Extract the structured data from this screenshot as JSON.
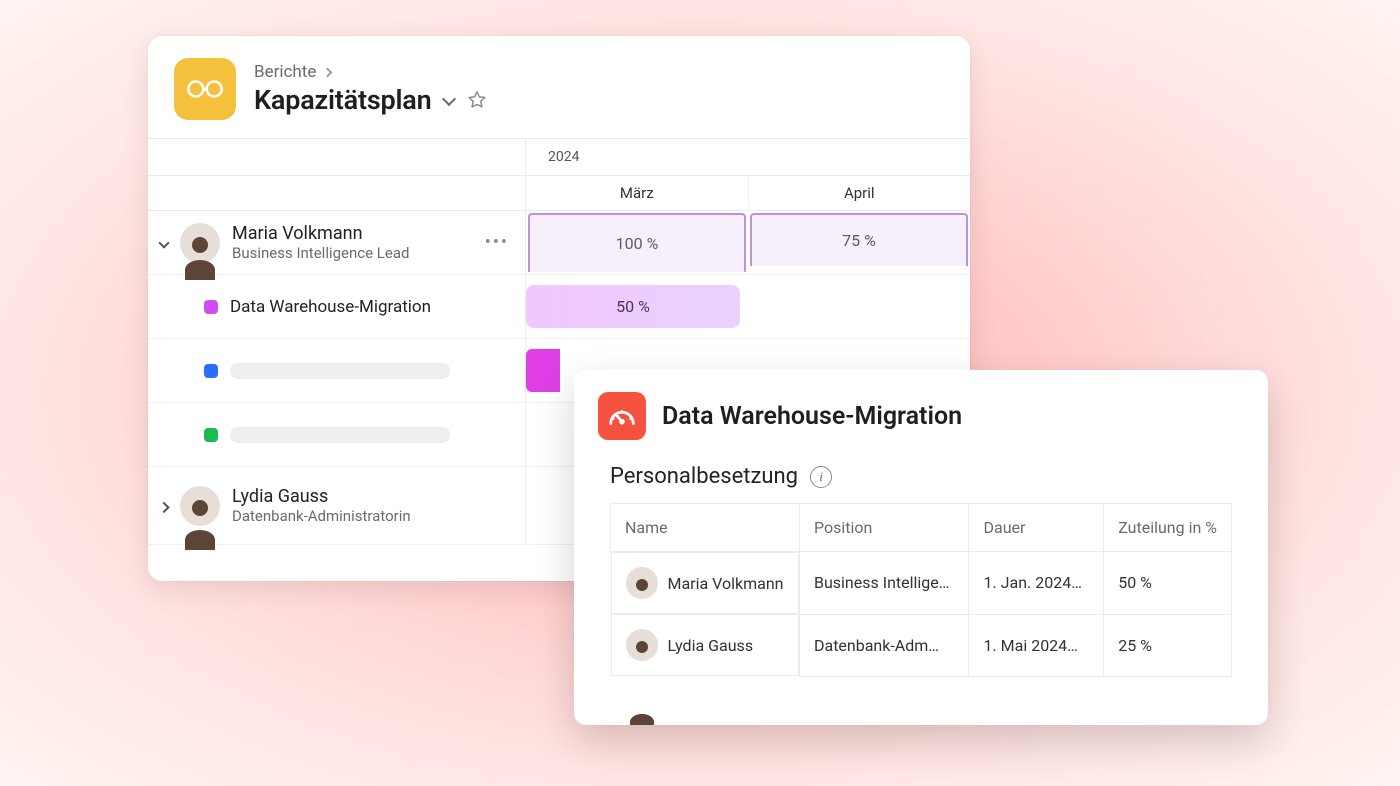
{
  "breadcrumb": {
    "parent": "Berichte"
  },
  "page": {
    "title": "Kapazitätsplan"
  },
  "timeline": {
    "year": "2024",
    "months": [
      "März",
      "April"
    ]
  },
  "colors": {
    "app_icon_bg": "#f5c13d",
    "popup_icon_bg": "#f5533d",
    "dot_purple": "#d24df0",
    "dot_blue": "#2f6bff",
    "dot_green": "#1db954",
    "bar_magenta": "#e13fe6"
  },
  "people": [
    {
      "name": "Maria Volkmann",
      "role": "Business Intelligence Lead",
      "expanded": true,
      "capacity": [
        {
          "month": "März",
          "label": "100 %"
        },
        {
          "month": "April",
          "label": "75 %"
        }
      ],
      "assignments": [
        {
          "label": "Data Warehouse-Migration",
          "dot": "dot_purple",
          "alloc_label": "50 %"
        },
        {
          "label": "",
          "dot": "dot_blue",
          "placeholder": true
        },
        {
          "label": "",
          "dot": "dot_green",
          "placeholder": true
        }
      ]
    },
    {
      "name": "Lydia Gauss",
      "role": "Datenbank-Administratorin",
      "expanded": false
    }
  ],
  "popup": {
    "title": "Data Warehouse-Migration",
    "section_title": "Personalbesetzung",
    "columns": [
      "Name",
      "Position",
      "Dauer",
      "Zuteilung in %"
    ],
    "rows": [
      {
        "name": "Maria Volkmann",
        "position": "Business Intellige…",
        "dauer": "1. Jan. 2024…",
        "alloc": "50 %"
      },
      {
        "name": "Lydia Gauss",
        "position": "Datenbank-Adm…",
        "dauer": "1. Mai 2024…",
        "alloc": "25 %"
      }
    ]
  }
}
